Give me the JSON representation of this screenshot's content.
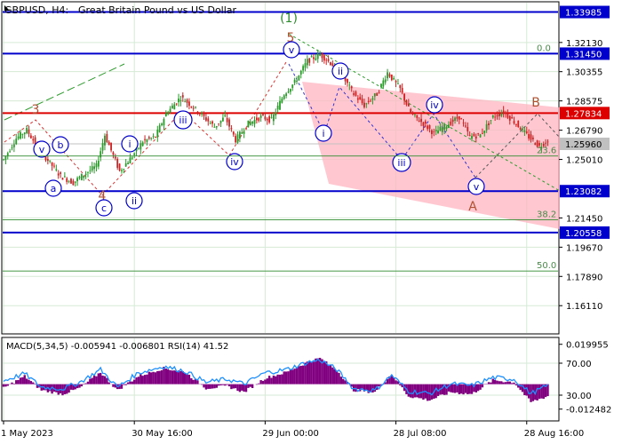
{
  "header": {
    "symbol": "GBPUSD, H4:",
    "description": "Great Britain Pound vs US Dollar"
  },
  "chart_data": [
    {
      "type": "candlestick",
      "title": "GBPUSD, H4:  Great Britain Pound vs US Dollar",
      "ylim": [
        1.145,
        1.345
      ],
      "y_ticks": [
        "1.32130",
        "1.30355",
        "1.28575",
        "1.26790",
        "1.25010",
        "1.21450",
        "1.19670",
        "1.17890",
        "1.16110"
      ],
      "x_ticks": [
        "1 May 2023",
        "30 May 16:00",
        "29 Jun 00:00",
        "28 Jul 08:00",
        "28 Aug 16:00"
      ],
      "price_series_by_index": [
        [
          0,
          1.25
        ],
        [
          6,
          1.263
        ],
        [
          11,
          1.268
        ],
        [
          16,
          1.258
        ],
        [
          22,
          1.248
        ],
        [
          27,
          1.24
        ],
        [
          33,
          1.236
        ],
        [
          38,
          1.241
        ],
        [
          44,
          1.246
        ],
        [
          48,
          1.265
        ],
        [
          55,
          1.243
        ],
        [
          61,
          1.252
        ],
        [
          66,
          1.261
        ],
        [
          72,
          1.264
        ],
        [
          77,
          1.278
        ],
        [
          84,
          1.288
        ],
        [
          89,
          1.283
        ],
        [
          94,
          1.277
        ],
        [
          100,
          1.27
        ],
        [
          105,
          1.276
        ],
        [
          110,
          1.262
        ],
        [
          116,
          1.272
        ],
        [
          122,
          1.276
        ],
        [
          127,
          1.274
        ],
        [
          133,
          1.29
        ],
        [
          138,
          1.297
        ],
        [
          144,
          1.31
        ],
        [
          150,
          1.314
        ],
        [
          155,
          1.309
        ],
        [
          160,
          1.302
        ],
        [
          166,
          1.29
        ],
        [
          171,
          1.283
        ],
        [
          177,
          1.29
        ],
        [
          182,
          1.303
        ],
        [
          188,
          1.293
        ],
        [
          193,
          1.278
        ],
        [
          199,
          1.272
        ],
        [
          204,
          1.266
        ],
        [
          210,
          1.271
        ],
        [
          216,
          1.276
        ],
        [
          221,
          1.264
        ],
        [
          226,
          1.265
        ],
        [
          232,
          1.276
        ],
        [
          237,
          1.279
        ],
        [
          243,
          1.272
        ],
        [
          248,
          1.265
        ],
        [
          254,
          1.258
        ],
        [
          258,
          1.262
        ]
      ],
      "horizontal_levels": [
        {
          "value": 1.33985,
          "label": "1.33985",
          "color": "#0000cc"
        },
        {
          "value": 1.3145,
          "label": "1.31450",
          "color": "#0000cc"
        },
        {
          "value": 1.27834,
          "label": "1.27834",
          "color": "#dd0000"
        },
        {
          "value": 1.2596,
          "label": "1.25960",
          "color": "#c0c0c0"
        },
        {
          "value": 1.23082,
          "label": "1.23082",
          "color": "#0000cc"
        },
        {
          "value": 1.20558,
          "label": "1.20558",
          "color": "#0000cc"
        }
      ],
      "fibonacci_levels": [
        {
          "value": 1.3145,
          "label": "0.0"
        },
        {
          "value": 1.2522,
          "label": "23.6"
        },
        {
          "value": 1.2134,
          "label": "38.2"
        },
        {
          "value": 1.1822,
          "label": "50.0"
        }
      ],
      "wave_labels": [
        {
          "text": "(1)",
          "color": "#2e8b2e",
          "style": "plain"
        },
        {
          "text": "5",
          "color": "#b05030",
          "style": "plain"
        },
        {
          "text": "3",
          "color": "#b05030",
          "style": "plain"
        },
        {
          "text": "4",
          "color": "#b05030",
          "style": "plain"
        },
        {
          "text": "A",
          "color": "#b05030",
          "style": "plain"
        },
        {
          "text": "B",
          "color": "#b05030",
          "style": "plain"
        },
        {
          "text": "v",
          "color": "#0000cc",
          "style": "circle"
        },
        {
          "text": "b",
          "color": "#0000cc",
          "style": "circle"
        },
        {
          "text": "a",
          "color": "#0000cc",
          "style": "circle"
        },
        {
          "text": "c",
          "color": "#0000cc",
          "style": "circle"
        },
        {
          "text": "i",
          "color": "#0000cc",
          "style": "circle"
        },
        {
          "text": "ii",
          "color": "#0000cc",
          "style": "circle"
        },
        {
          "text": "iii",
          "color": "#0000cc",
          "style": "circle"
        },
        {
          "text": "iv",
          "color": "#0000cc",
          "style": "circle"
        },
        {
          "text": "v",
          "color": "#0000cc",
          "style": "circle"
        },
        {
          "text": "i",
          "color": "#0000cc",
          "style": "circle"
        },
        {
          "text": "ii",
          "color": "#0000cc",
          "style": "circle"
        },
        {
          "text": "iii",
          "color": "#0000cc",
          "style": "circle"
        },
        {
          "text": "iv",
          "color": "#0000cc",
          "style": "circle"
        },
        {
          "text": "v",
          "color": "#0000cc",
          "style": "circle"
        }
      ],
      "colors": {
        "up": "#2a9a2a",
        "down": "#cc2222",
        "channel": "#ffb6c1",
        "grid": "#d6ead6"
      }
    },
    {
      "type": "macd_rsi",
      "title": "MACD(5,34,5) -0.005941 -0.006801 RSI(14) 41.52",
      "macd": {
        "fast": 5,
        "slow": 34,
        "signal": 5,
        "main": -0.005941,
        "signal_value": -0.006801
      },
      "rsi": {
        "period": 14,
        "value": 41.52
      },
      "ylim": [
        -0.0175,
        0.0225
      ],
      "y_ticks": [
        "0.019955",
        "70.00",
        "30.00",
        "-0.012482"
      ],
      "rsi_levels": [
        70,
        30
      ],
      "histogram_by_index": [
        [
          0,
          -0.002
        ],
        [
          10,
          0.004
        ],
        [
          18,
          -0.003
        ],
        [
          28,
          -0.005
        ],
        [
          36,
          -0.002
        ],
        [
          46,
          0.006
        ],
        [
          54,
          -0.003
        ],
        [
          64,
          0.004
        ],
        [
          76,
          0.008
        ],
        [
          86,
          0.006
        ],
        [
          96,
          -0.002
        ],
        [
          106,
          -0.001
        ],
        [
          114,
          -0.004
        ],
        [
          124,
          0.003
        ],
        [
          134,
          0.006
        ],
        [
          144,
          0.011
        ],
        [
          150,
          0.013
        ],
        [
          158,
          0.007
        ],
        [
          166,
          -0.003
        ],
        [
          176,
          -0.004
        ],
        [
          184,
          0.005
        ],
        [
          192,
          -0.006
        ],
        [
          202,
          -0.008
        ],
        [
          212,
          -0.004
        ],
        [
          222,
          -0.005
        ],
        [
          232,
          0.002
        ],
        [
          242,
          0.001
        ],
        [
          250,
          -0.009
        ],
        [
          258,
          -0.006
        ]
      ],
      "rsi_by_index": [
        [
          0,
          48
        ],
        [
          10,
          57
        ],
        [
          18,
          40
        ],
        [
          28,
          38
        ],
        [
          36,
          46
        ],
        [
          46,
          62
        ],
        [
          54,
          40
        ],
        [
          64,
          58
        ],
        [
          76,
          66
        ],
        [
          86,
          60
        ],
        [
          96,
          46
        ],
        [
          106,
          50
        ],
        [
          114,
          44
        ],
        [
          124,
          58
        ],
        [
          134,
          62
        ],
        [
          144,
          71
        ],
        [
          150,
          74
        ],
        [
          158,
          62
        ],
        [
          166,
          38
        ],
        [
          176,
          36
        ],
        [
          184,
          55
        ],
        [
          192,
          35
        ],
        [
          202,
          32
        ],
        [
          212,
          44
        ],
        [
          222,
          42
        ],
        [
          232,
          52
        ],
        [
          242,
          50
        ],
        [
          250,
          32
        ],
        [
          258,
          42
        ]
      ],
      "colors": {
        "histogram": "#800080",
        "rsi": "#1e90ff"
      }
    }
  ]
}
